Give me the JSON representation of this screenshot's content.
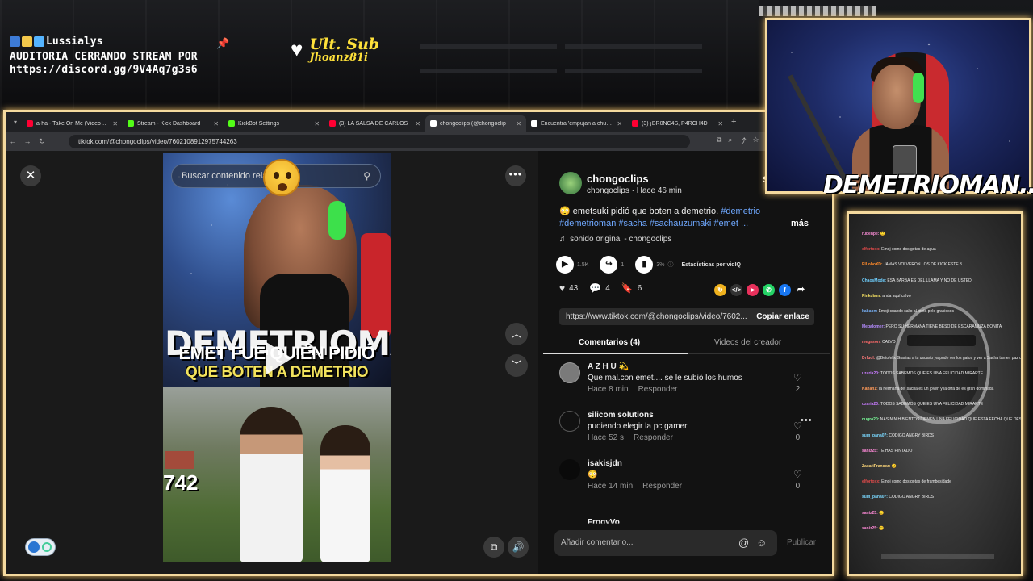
{
  "overlay": {
    "channel_name": "Lussialys",
    "line1": "AUDITORIA CERRANDO STREAM POR",
    "line2": "https://discord.gg/9V4Aq7g3s6",
    "ult_sub_label": "Ult. Sub",
    "ult_sub_user": "Jhoanz81i",
    "webcam_name": "DEMETRIOMAN....",
    "accent_color": "#f4d99e"
  },
  "browser": {
    "tabs": [
      {
        "title": "a-ha - Take On Me (Video Ofic",
        "favicon_color": "#ff0033"
      },
      {
        "title": "Stream - Kick Dashboard",
        "favicon_color": "#53fc18"
      },
      {
        "title": "KickBot Settings",
        "favicon_color": "#53fc18"
      },
      {
        "title": "(3) LA SALSA DE CARLOS",
        "favicon_color": "#ff0033"
      },
      {
        "title": "chongoclips (@chongoclip",
        "favicon_color": "#ffffff",
        "active": true
      },
      {
        "title": "Encuentra 'empujan a chuny' e",
        "favicon_color": "#ffffff"
      },
      {
        "title": "(3) ¡BR0NC4S, P4RCH4D",
        "favicon_color": "#ff0033"
      }
    ],
    "new_tab": "+",
    "url": "tiktok.com/@chongoclips/video/7602108912975744263"
  },
  "video": {
    "search_placeholder": "Buscar contenido relacionado",
    "overlay_title": "DEMETRIOMAN",
    "caption_line1": "EMET FUE QUIÉN PIDIÓ",
    "caption_line2": "QUE BOTEN A DEMETRIO",
    "sign_text": "742"
  },
  "post": {
    "author": "chongoclips",
    "author_sub": "chongoclips · Hace 46 min",
    "follow_label": "S",
    "desc_text": "😳 emetsuki pidió que boten a demetrio.",
    "hashtags": "#demetrio #demetrioman #sacha #sachauzumaki #emet ...",
    "more_label": "más",
    "music": "sonido original - chongoclips",
    "plays": "1.5K",
    "shares_small": "1",
    "stat_pct": "3%",
    "vidiq_label": "Estadísticas por vidIQ",
    "likes": "43",
    "comments_count": "4",
    "saves": "6",
    "link": "https://www.tiktok.com/@chongoclips/video/7602...",
    "copy_label": "Copiar enlace",
    "tab_comments": "Comentarios (4)",
    "tab_creator": "Videos del creador"
  },
  "comments": [
    {
      "user": "A Z H U 💫",
      "text": "Que mal.con emet.... se le subió los humos",
      "time": "Hace 8 min",
      "reply": "Responder",
      "likes": "2",
      "avatar_color": "#7a7a7a"
    },
    {
      "user": "silicom solutions",
      "text": "pudiendo elegir la pc gamer",
      "time": "Hace 52 s",
      "reply": "Responder",
      "likes": "0",
      "avatar_color": "#111111"
    },
    {
      "user": "isakisjdn",
      "text": "😳",
      "time": "Hace 14 min",
      "reply": "Responder",
      "likes": "0",
      "avatar_color": "#0a0a0a"
    }
  ],
  "comment_partial_user": "FrogyVo",
  "add_comment_placeholder": "Añadir comentario...",
  "publish_label": "Publicar",
  "chat": [
    {
      "user": "rubenpe:",
      "msg": "🙂",
      "color": "#f58ad1"
    },
    {
      "user": "elfortoxx:",
      "msg": "Emoj como dos gotas de agua",
      "color": "#e24a4a"
    },
    {
      "user": "ElLoboXD:",
      "msg": "JAMAS VOLVERON LOS DE KICK ESTE 3",
      "color": "#ff8a2a"
    },
    {
      "user": "ChaosMode:",
      "msg": "ESA BARBA ES DEL LLAMA Y NO DE USTED",
      "color": "#6fd0ff"
    },
    {
      "user": "Pinkdiam:",
      "msg": "anda aquí calvo",
      "color": "#f5e062"
    },
    {
      "user": "kabaon:",
      "msg": "Emoji cuando salio al tenía pelo graciosos",
      "color": "#7ab6ff"
    },
    {
      "user": "Megalomer:",
      "msg": "PERO SU HERMANA TIENE BESO DE ESCARAMUZA BONITA",
      "color": "#b58cff"
    },
    {
      "user": "megason:",
      "msg": "CALVO",
      "color": "#ff6a6a"
    },
    {
      "user": "Drfuol:",
      "msg": "@Betofelix Gracias a tu usuario ya pude ver los gatos y ver a Sacha tan en paz de doble",
      "color": "#ff7a7a"
    },
    {
      "user": "uzaria20:",
      "msg": "TODOS SABEMOS QUE ES UNA FELICIDAD MIRARTE",
      "color": "#c87aff"
    },
    {
      "user": "Kanan1:",
      "msg": "la hermana del sacha es un joven y la otra de es gran dominada",
      "color": "#ff9a5a"
    },
    {
      "user": "uzaria20:",
      "msg": "TODOS SABEMOS QUE ES UNA FELICIDAD MIRARTE",
      "color": "#c87aff"
    },
    {
      "user": "nugro20:",
      "msg": "NAS NIN HIBIENTOS TIENEN UNA FELICIDAD QUE ESTA FECHA QUE DESEAN",
      "color": "#7aff9a"
    },
    {
      "user": "sum_pana07:",
      "msg": "CODIGO ANGRY BIRDS",
      "color": "#7ad8ff"
    },
    {
      "user": "saniz25:",
      "msg": "TE HAS PINTADO",
      "color": "#ff8ad8"
    },
    {
      "user": "ZacariFrancez:",
      "msg": "🙂",
      "color": "#ffd87a"
    },
    {
      "user": "elfortoxx:",
      "msg": "Emoj como dos gotas de frambesidade",
      "color": "#e24a4a"
    },
    {
      "user": "sum_pana07:",
      "msg": "CODIGO ANGRY BIRDS",
      "color": "#7ad8ff"
    },
    {
      "user": "saniz25:",
      "msg": "🙂",
      "color": "#ff8ad8"
    },
    {
      "user": "saniz25:",
      "msg": "🙂",
      "color": "#ff8ad8"
    }
  ]
}
